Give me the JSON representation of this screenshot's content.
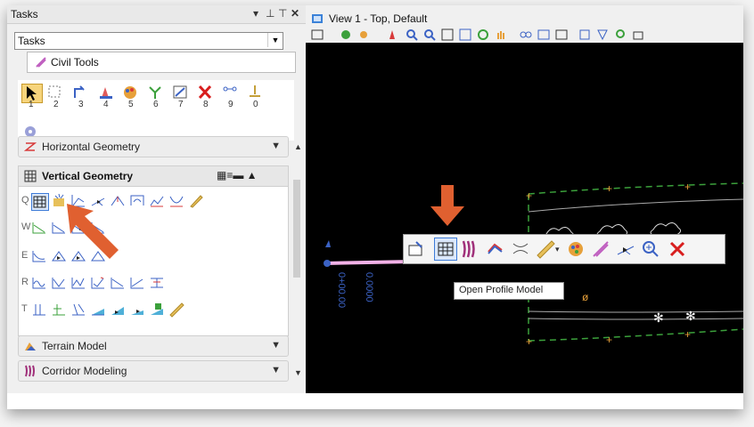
{
  "tasks": {
    "title": "Tasks",
    "dropdown_value": "Tasks",
    "subheading": "Civil Tools",
    "tool_keys": [
      "1",
      "2",
      "3",
      "4",
      "5",
      "6",
      "7",
      "8",
      "9",
      "0"
    ],
    "sections": {
      "horizontal_geometry": "Horizontal Geometry",
      "vertical_geometry": "Vertical Geometry",
      "terrain_model": "Terrain Model",
      "corridor_modeling": "Corridor Modeling"
    },
    "row_keys": [
      "Q",
      "W",
      "E",
      "R",
      "T"
    ]
  },
  "view": {
    "title": "View 1 - Top, Default",
    "station_label": "0+00.00",
    "offset_label": "0.0000"
  },
  "tooltip": "Open Profile Model",
  "colors": {
    "accent_arrow": "#e06030",
    "selection_blue": "#3d7bd8",
    "delete_red": "#d81e1e"
  }
}
